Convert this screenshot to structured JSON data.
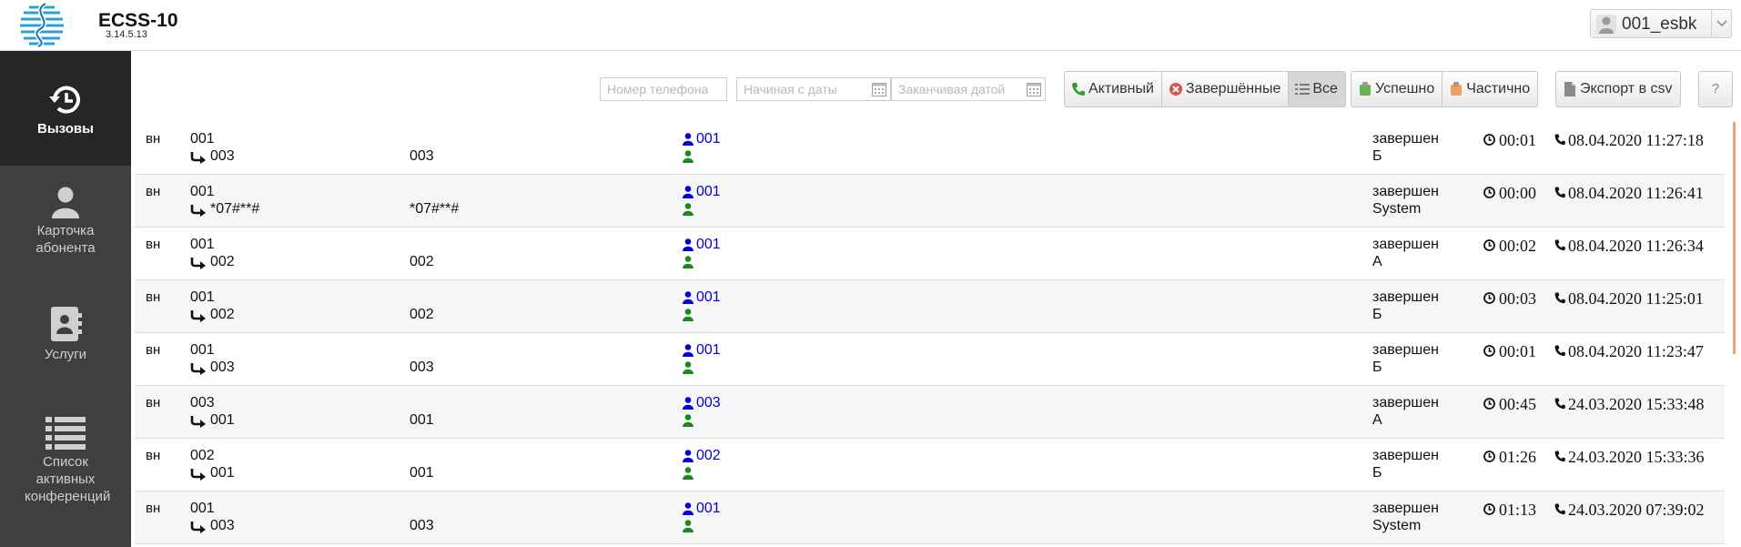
{
  "header": {
    "app_title": "ECSS-10",
    "app_version": "3.14.5.13",
    "user_name": "001_esbk"
  },
  "sidebar": {
    "items": [
      {
        "label": "Вызовы",
        "icon": "history-icon",
        "active": true
      },
      {
        "label": "Карточка абонента",
        "icon": "user-icon",
        "active": false
      },
      {
        "label": "Услуги",
        "icon": "contact-book-icon",
        "active": false
      },
      {
        "label": "Список активных конференций",
        "icon": "list-icon",
        "active": false
      }
    ]
  },
  "filters": {
    "phone_placeholder": "Номер телефона",
    "date_from_placeholder": "Начиная с даты",
    "date_to_placeholder": "Заканчивая датой",
    "state_buttons": [
      {
        "label": "Активный",
        "icon": "phone-icon",
        "pressed": false
      },
      {
        "label": "Завершённые",
        "icon": "close-circle-icon",
        "pressed": false
      },
      {
        "label": "Все",
        "icon": "list-icon",
        "pressed": true
      }
    ],
    "result_buttons": [
      {
        "label": "Успешно",
        "icon": "success-icon"
      },
      {
        "label": "Частично",
        "icon": "partial-icon"
      }
    ],
    "export_label": "Экспорт в csv",
    "help_label": "?"
  },
  "calls": [
    {
      "type": "вн",
      "from": "001",
      "to": "003",
      "dest": "003",
      "user": "001",
      "status": "завершен",
      "reason": "Б",
      "duration": "00:01",
      "datetime": "08.04.2020 11:27:18"
    },
    {
      "type": "вн",
      "from": "001",
      "to": "*07#**#",
      "dest": "*07#**#",
      "user": "001",
      "status": "завершен",
      "reason": "System",
      "duration": "00:00",
      "datetime": "08.04.2020 11:26:41"
    },
    {
      "type": "вн",
      "from": "001",
      "to": "002",
      "dest": "002",
      "user": "001",
      "status": "завершен",
      "reason": "А",
      "duration": "00:02",
      "datetime": "08.04.2020 11:26:34"
    },
    {
      "type": "вн",
      "from": "001",
      "to": "002",
      "dest": "002",
      "user": "001",
      "status": "завершен",
      "reason": "Б",
      "duration": "00:03",
      "datetime": "08.04.2020 11:25:01"
    },
    {
      "type": "вн",
      "from": "001",
      "to": "003",
      "dest": "003",
      "user": "001",
      "status": "завершен",
      "reason": "Б",
      "duration": "00:01",
      "datetime": "08.04.2020 11:23:47"
    },
    {
      "type": "вн",
      "from": "003",
      "to": "001",
      "dest": "001",
      "user": "003",
      "status": "завершен",
      "reason": "А",
      "duration": "00:45",
      "datetime": "24.03.2020 15:33:48"
    },
    {
      "type": "вн",
      "from": "002",
      "to": "001",
      "dest": "001",
      "user": "002",
      "status": "завершен",
      "reason": "Б",
      "duration": "01:26",
      "datetime": "24.03.2020 15:33:36"
    },
    {
      "type": "вн",
      "from": "001",
      "to": "003",
      "dest": "003",
      "user": "001",
      "status": "завершен",
      "reason": "System",
      "duration": "01:13",
      "datetime": "24.03.2020 07:39:02"
    }
  ],
  "colors": {
    "sidebar_bg": "#3f3f3f",
    "sidebar_active_bg": "#262626",
    "user_link": "#0000dd",
    "user_online": "#1a8c1a",
    "logo_blue": "#2aa0d8"
  }
}
